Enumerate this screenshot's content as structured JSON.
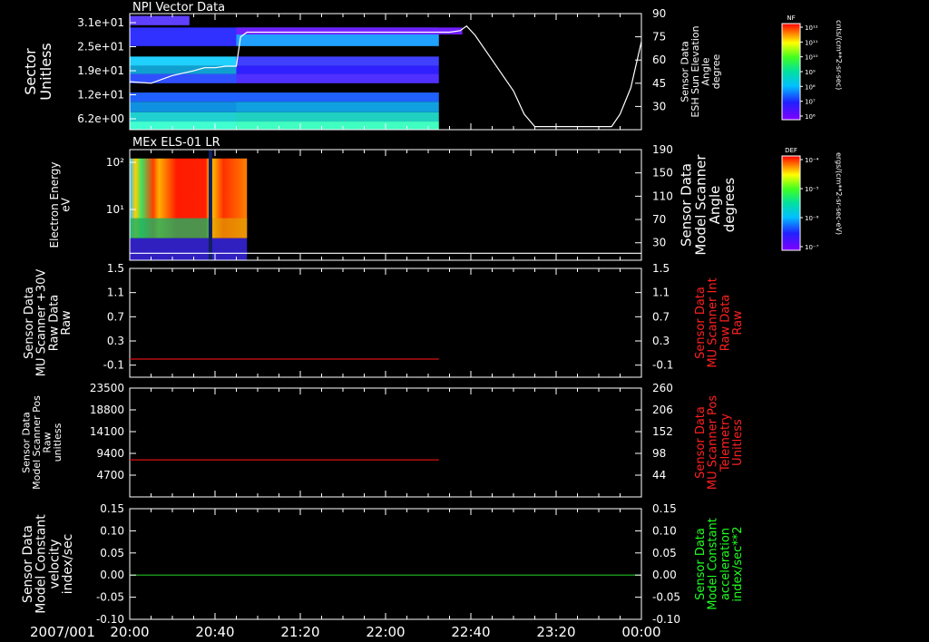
{
  "x_axis": {
    "date_label": "2007/001",
    "ticks": [
      "20:00",
      "20:40",
      "21:20",
      "22:00",
      "22:40",
      "23:20",
      "00:00"
    ],
    "range": [
      "20:00",
      "24:00"
    ]
  },
  "colorbars": [
    {
      "tag": "NF",
      "units": "cnts/(cm**2-sr-sec)",
      "ticks": [
        "10¹²",
        "10¹¹",
        "10¹⁰",
        "10⁹",
        "10⁸",
        "10⁷",
        "10⁶"
      ]
    },
    {
      "tag": "DEF",
      "units": "ergs/(cm**2-sr-sec-eV)",
      "ticks": [
        "10⁻⁴",
        "10⁻⁵",
        "10⁻⁶",
        "10⁻⁷"
      ]
    }
  ],
  "chart_data": [
    {
      "type": "heatmap",
      "title": "NPI Vector Data",
      "ylabel": [
        "Sector",
        "Unitless"
      ],
      "yticks": [
        "3.1e+01",
        "2.5e+01",
        "1.9e+01",
        "1.2e+01",
        "6.2e+00"
      ],
      "y2label": [
        "Sensor Data",
        "ESH Sun Elevation",
        "Angle",
        "degree"
      ],
      "y2ticks": [
        "90",
        "75",
        "60",
        "45",
        "30"
      ],
      "y2lim": [
        15,
        90
      ],
      "data_end": "22:25",
      "colorbar": "NF",
      "overlay_line": {
        "name": "ESH Sun Elevation Angle",
        "color": "#ffffff",
        "x": [
          "20:00",
          "20:10",
          "20:20",
          "20:30",
          "20:35",
          "20:40",
          "20:45",
          "20:50",
          "20:52",
          "20:55",
          "21:00",
          "22:00",
          "22:30",
          "22:35",
          "22:38",
          "22:42",
          "22:50",
          "23:00",
          "23:05",
          "23:10",
          "23:20",
          "23:40",
          "23:46",
          "23:50",
          "23:55",
          "24:00"
        ],
        "y": [
          46,
          45,
          50,
          53,
          55,
          55,
          56,
          56,
          75,
          78,
          78,
          78,
          78,
          79,
          82,
          76,
          60,
          40,
          25,
          17,
          17,
          17,
          17,
          25,
          42,
          72
        ]
      }
    },
    {
      "type": "heatmap",
      "title": "MEx ELS-01 LR",
      "ylabel": [
        "Electron Energy",
        "eV"
      ],
      "yticks": [
        "10²",
        "10¹"
      ],
      "y2label": [
        "Sensor Data",
        "Model Scanner",
        "Angle",
        "degrees"
      ],
      "y2ticks": [
        "190",
        "150",
        "110",
        "70",
        "30"
      ],
      "y2lim": [
        0,
        190
      ],
      "data_end": "20:55",
      "colorbar": "DEF",
      "overlay_line": {
        "name": "Model Scanner Angle",
        "color": "#ffffff",
        "x": [
          "20:00",
          "24:00"
        ],
        "y": [
          12,
          12
        ]
      }
    },
    {
      "type": "line",
      "ylabel": [
        "Sensor Data",
        "MU Scanner +30V",
        "Raw Data",
        "Raw"
      ],
      "yticks": [
        "1.5",
        "1.1",
        "0.7",
        "0.3",
        "-0.1"
      ],
      "ylim": [
        -0.3,
        1.5
      ],
      "y2label": [
        "Sensor Data",
        "MU Scanner Int",
        "Raw Data",
        "Raw"
      ],
      "y2ticks": [
        "1.5",
        "1.1",
        "0.7",
        "0.3",
        "-0.1"
      ],
      "y2_color": "#ff2020",
      "series": [
        {
          "name": "MU Scanner Int Raw Data",
          "color": "#dd1010",
          "x": [
            "20:00",
            "22:25"
          ],
          "y": [
            0,
            0
          ]
        }
      ]
    },
    {
      "type": "line",
      "ylabel": [
        "Sensor Data",
        "Model Scanner Pos",
        "Raw",
        "unitless"
      ],
      "yticks": [
        "23500",
        "18800",
        "14100",
        "9400",
        "4700"
      ],
      "ylim": [
        0,
        23500
      ],
      "y2label": [
        "Sensor Data",
        "MU Scanner Pos",
        "Telemetry",
        "Unitless"
      ],
      "y2ticks": [
        "260",
        "206",
        "152",
        "98",
        "44"
      ],
      "y2_color": "#ff2020",
      "series": [
        {
          "name": "MU Scanner Pos Telemetry",
          "color": "#dd1010",
          "x": [
            "20:00",
            "22:25"
          ],
          "y": [
            8000,
            8000
          ]
        }
      ]
    },
    {
      "type": "line",
      "ylabel": [
        "Sensor Data",
        "Model Constant",
        "velocity",
        "index/sec"
      ],
      "yticks": [
        "0.15",
        "0.10",
        "0.05",
        "0.00",
        "-0.05",
        "-0.10"
      ],
      "ylim": [
        -0.1,
        0.15
      ],
      "y2label": [
        "Sensor Data",
        "Model Constant",
        "acceleration",
        "index/sec**2"
      ],
      "y2ticks": [
        "0.15",
        "0.10",
        "0.05",
        "0.00",
        "-0.05",
        "-0.10"
      ],
      "y2_color": "#20ff20",
      "series": [
        {
          "name": "Model Constant acceleration",
          "color": "#20c020",
          "x": [
            "20:00",
            "24:00"
          ],
          "y": [
            0,
            0
          ]
        }
      ]
    }
  ]
}
